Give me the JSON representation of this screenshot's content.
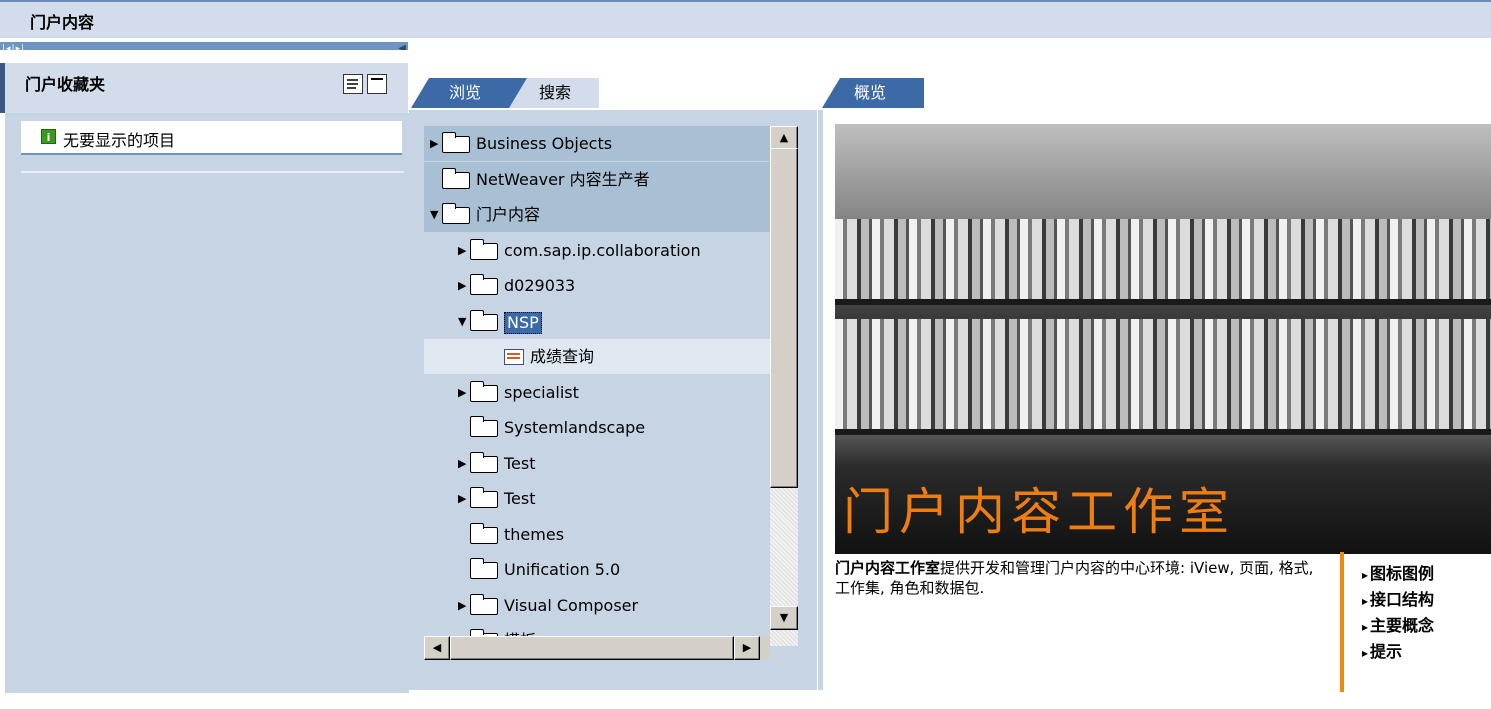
{
  "header": {
    "title": "门户内容"
  },
  "left": {
    "title": "门户收藏夹",
    "item": "无要显示的项目"
  },
  "middle": {
    "tabs": [
      {
        "label": "浏览"
      },
      {
        "label": "搜索"
      }
    ],
    "tree": [
      {
        "label": "Business Objects",
        "arrow": "▶",
        "type": "folder"
      },
      {
        "label": "NetWeaver 内容生产者",
        "arrow": "",
        "type": "folder"
      },
      {
        "label": "门户内容",
        "arrow": "▼",
        "type": "folder"
      },
      {
        "label": "com.sap.ip.collaboration",
        "arrow": "▶",
        "type": "folder"
      },
      {
        "label": "d029033",
        "arrow": "▶",
        "type": "folder"
      },
      {
        "label": "NSP",
        "arrow": "▼",
        "type": "folder"
      },
      {
        "label": "成绩查询",
        "arrow": "",
        "type": "page"
      },
      {
        "label": "specialist",
        "arrow": "▶",
        "type": "folder"
      },
      {
        "label": "Systemlandscape",
        "arrow": "",
        "type": "folder"
      },
      {
        "label": "Test",
        "arrow": "▶",
        "type": "folder"
      },
      {
        "label": "Test",
        "arrow": "▶",
        "type": "folder"
      },
      {
        "label": "themes",
        "arrow": "",
        "type": "folder"
      },
      {
        "label": "Unification 5.0",
        "arrow": "",
        "type": "folder"
      },
      {
        "label": "Visual Composer",
        "arrow": "▶",
        "type": "folder"
      },
      {
        "label": "模板",
        "arrow": "▶",
        "type": "folder"
      }
    ]
  },
  "right": {
    "tab": "概览",
    "hero_caption": "门户内容工作室",
    "desc_bold": "门户内容工作室",
    "desc_rest": "提供开发和管理门户内容的中心环境: iView, 页面, 格式, 工作集, 角色和数据包.",
    "links": [
      "图标图例",
      "接口结构",
      "主要概念",
      "提示"
    ]
  },
  "colors": {
    "accent": "#3c6aa6",
    "header_bg": "#d2dcea",
    "orange": "#ee7d14"
  }
}
